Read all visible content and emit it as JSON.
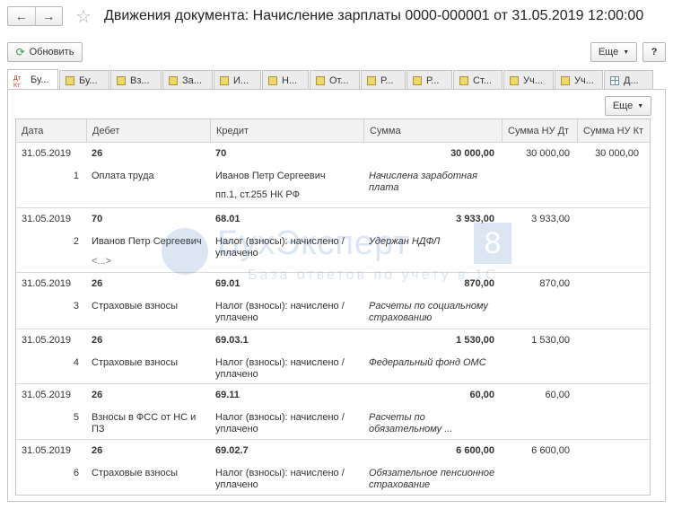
{
  "window": {
    "title": "Движения документа: Начисление зарплаты 0000-000001 от 31.05.2019 12:00:00",
    "back_icon": "arrow-left",
    "forward_icon": "arrow-right",
    "favorite_icon": "star"
  },
  "toolbar": {
    "refresh_label": "Обновить",
    "more_label": "Еще",
    "help_label": "?"
  },
  "tabs": [
    {
      "label": "Бу...",
      "icon": "dt-kt",
      "active": true
    },
    {
      "label": "Бу...",
      "icon": "register"
    },
    {
      "label": "Вз...",
      "icon": "register"
    },
    {
      "label": "За...",
      "icon": "register"
    },
    {
      "label": "И...",
      "icon": "register"
    },
    {
      "label": "Н...",
      "icon": "register"
    },
    {
      "label": "От...",
      "icon": "register"
    },
    {
      "label": "Р...",
      "icon": "register"
    },
    {
      "label": "Р...",
      "icon": "register"
    },
    {
      "label": "Ст...",
      "icon": "register"
    },
    {
      "label": "Уч...",
      "icon": "register"
    },
    {
      "label": "Уч...",
      "icon": "register"
    },
    {
      "label": "Д...",
      "icon": "grid"
    }
  ],
  "grid": {
    "more_label": "Еще",
    "columns": [
      "Дата",
      "Дебет",
      "Кредит",
      "Сумма",
      "Сумма НУ Дт",
      "Сумма НУ Кт"
    ],
    "rows": [
      {
        "date": "31.05.2019",
        "n": "1",
        "debit": "26",
        "debit_sub": "Оплата труда",
        "debit_sub2": "",
        "credit": "70",
        "credit_sub": "Иванов Петр Сергеевич",
        "credit_sub2": "пп.1, ст.255 НК РФ",
        "sum": "30 000,00",
        "sum_desc": "Начислена заработная плата",
        "nu_dt": "30 000,00",
        "nu_kt": "30 000,00"
      },
      {
        "date": "31.05.2019",
        "n": "2",
        "debit": "70",
        "debit_sub": "Иванов Петр Сергеевич",
        "debit_sub2": "<...>",
        "credit": "68.01",
        "credit_sub": "Налог (взносы): начислено / уплачено",
        "credit_sub2": "",
        "sum": "3 933,00",
        "sum_desc": "Удержан НДФЛ",
        "nu_dt": "3 933,00",
        "nu_kt": ""
      },
      {
        "date": "31.05.2019",
        "n": "3",
        "debit": "26",
        "debit_sub": "Страховые взносы",
        "debit_sub2": "",
        "credit": "69.01",
        "credit_sub": "Налог (взносы): начислено / уплачено",
        "credit_sub2": "",
        "sum": "870,00",
        "sum_desc": "Расчеты по социальному страхованию",
        "nu_dt": "870,00",
        "nu_kt": ""
      },
      {
        "date": "31.05.2019",
        "n": "4",
        "debit": "26",
        "debit_sub": "Страховые взносы",
        "debit_sub2": "",
        "credit": "69.03.1",
        "credit_sub": "Налог (взносы): начислено / уплачено",
        "credit_sub2": "",
        "sum": "1 530,00",
        "sum_desc": "Федеральный фонд ОМС",
        "nu_dt": "1 530,00",
        "nu_kt": ""
      },
      {
        "date": "31.05.2019",
        "n": "5",
        "debit": "26",
        "debit_sub": "Взносы в ФСС от НС и ПЗ",
        "debit_sub2": "",
        "credit": "69.11",
        "credit_sub": "Налог (взносы): начислено / уплачено",
        "credit_sub2": "",
        "sum": "60,00",
        "sum_desc": "Расчеты по обязательному ...",
        "nu_dt": "60,00",
        "nu_kt": ""
      },
      {
        "date": "31.05.2019",
        "n": "6",
        "debit": "26",
        "debit_sub": "Страховые взносы",
        "debit_sub2": "",
        "credit": "69.02.7",
        "credit_sub": "Налог (взносы): начислено / уплачено",
        "credit_sub2": "",
        "sum": "6 600,00",
        "sum_desc": "Обязательное пенсионное страхование",
        "nu_dt": "6 600,00",
        "nu_kt": ""
      }
    ]
  },
  "watermark": {
    "brand": "БухЭксперт",
    "digit": "8",
    "tagline": "База ответов по учету в 1С"
  }
}
